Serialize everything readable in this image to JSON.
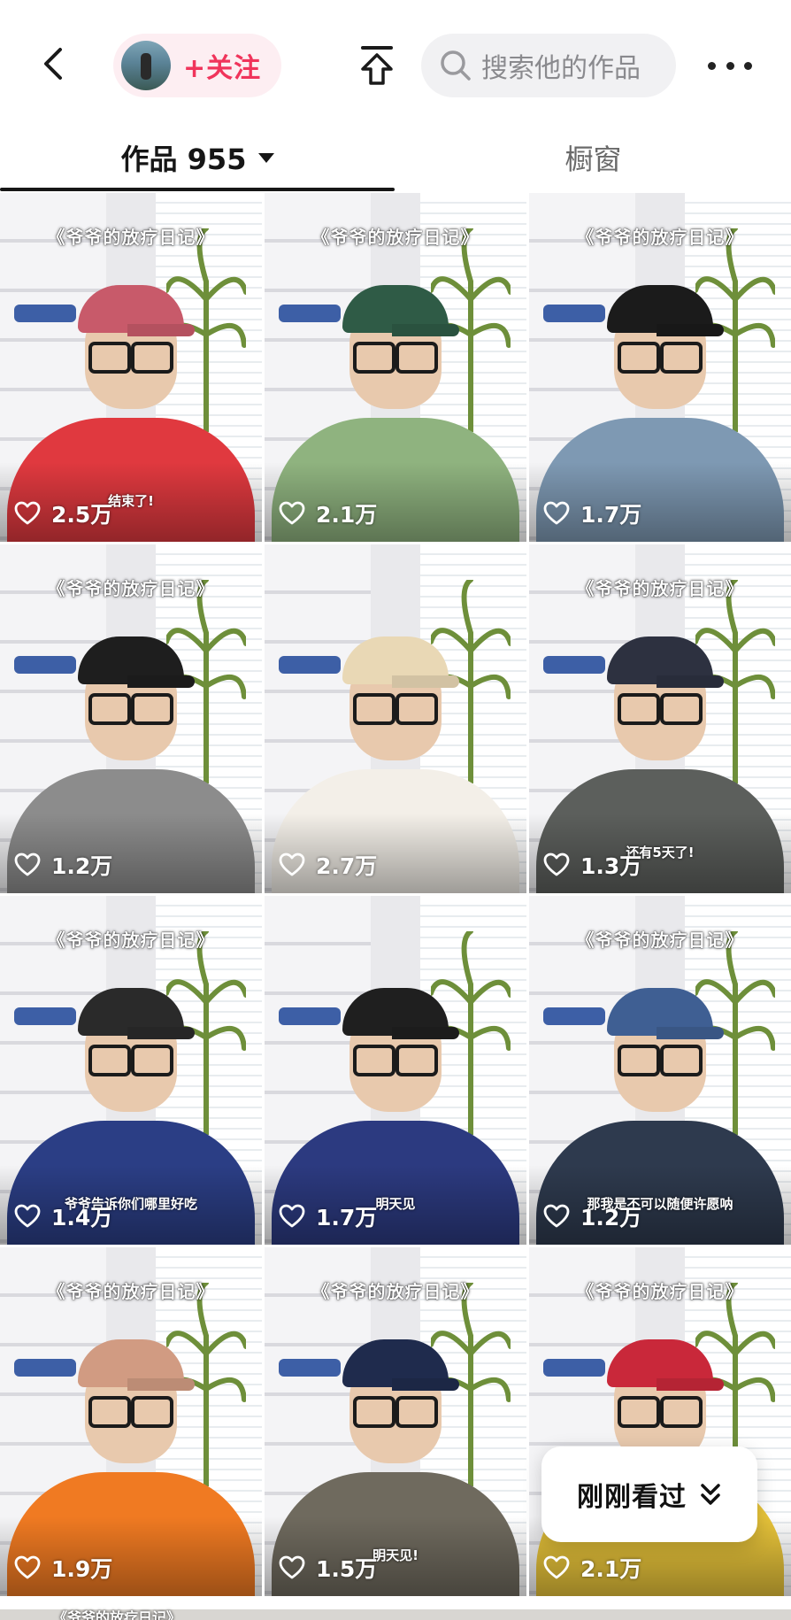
{
  "header": {
    "follow_label": "+关注",
    "search_placeholder": "搜索他的作品"
  },
  "tabs": [
    {
      "label": "作品 955",
      "active": true
    },
    {
      "label": "橱窗",
      "active": false
    }
  ],
  "colors": {
    "accent": "#f0345b",
    "follow_bg": "#fdeef2",
    "search_bg": "#f1f1f3"
  },
  "videos": [
    {
      "likes": "2.5万",
      "caption": "《爷爷的放疗日记》",
      "subtitle": "结束了!",
      "hat": "#c85a6a",
      "shirt": "#e0393f"
    },
    {
      "likes": "2.1万",
      "caption": "《爷爷的放疗日记》",
      "subtitle": "",
      "hat": "#2f5b46",
      "shirt": "#8fb37f"
    },
    {
      "likes": "1.7万",
      "caption": "《爷爷的放疗日记》",
      "subtitle": "",
      "hat": "#1b1b1b",
      "shirt": "#7e99b3"
    },
    {
      "likes": "1.2万",
      "caption": "《爷爷的放疗日记》",
      "subtitle": "",
      "hat": "#1e1e1e",
      "shirt": "#8c8c8c"
    },
    {
      "likes": "2.7万",
      "caption": "",
      "subtitle": "",
      "hat": "#e9d8b5",
      "shirt": "#f3efe8"
    },
    {
      "likes": "1.3万",
      "caption": "《爷爷的放疗日记》",
      "subtitle": "还有5天了!",
      "hat": "#2d3140",
      "shirt": "#5c5f5c"
    },
    {
      "likes": "1.4万",
      "caption": "《爷爷的放疗日记》",
      "subtitle": "爷爷告诉你们哪里好吃",
      "hat": "#2a2a2a",
      "shirt": "#2b3e85"
    },
    {
      "likes": "1.7万",
      "caption": "",
      "subtitle": "明天见",
      "hat": "#1f1f1f",
      "shirt": "#2c3a80"
    },
    {
      "likes": "1.2万",
      "caption": "《爷爷的放疗日记》",
      "subtitle": "那我是不可以随便许愿呐",
      "hat": "#3f5f93",
      "shirt": "#2e3a4e"
    },
    {
      "likes": "1.9万",
      "caption": "《爷爷的放疗日记》",
      "subtitle": "",
      "hat": "#d19b82",
      "shirt": "#f07a22"
    },
    {
      "likes": "1.5万",
      "caption": "《爷爷的放疗日记》",
      "subtitle": "明天见!",
      "hat": "#1f2b4d",
      "shirt": "#6f6a5e"
    },
    {
      "likes": "2.1万",
      "caption": "《爷爷的放疗日记》",
      "subtitle": "",
      "hat": "#c9283a",
      "shirt": "#e8c43a"
    }
  ],
  "bottom_row_caption": "《爷爷的放疗日记》",
  "recent_button": {
    "label": "刚刚看过"
  },
  "icons": {
    "back": "chevron-left-icon",
    "share": "share-upload-icon",
    "search": "search-icon",
    "more": "more-dots-icon",
    "like": "heart-icon",
    "caret": "caret-down-icon",
    "recent": "double-chevron-down-icon"
  }
}
